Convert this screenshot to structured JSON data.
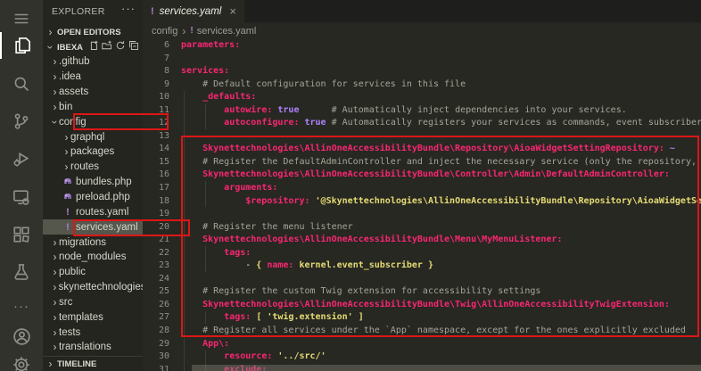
{
  "glyphs": {
    "yaml_bang": "!",
    "close": "×",
    "more": "···",
    "chevron": "›"
  },
  "colors": {
    "annotation_red": "#dd1616",
    "key_pink": "#f92672",
    "value_purple": "#ae81ff",
    "string_yellow": "#e6db74",
    "comment_gray": "#a6a599",
    "editor_bg": "#272822",
    "sidebar_bg": "#24251f"
  },
  "activity_bar": {
    "items": [
      "menu-icon",
      "explorer-icon",
      "search-icon",
      "source-control-icon",
      "run-debug-icon",
      "remote-explorer-icon",
      "extensions-icon",
      "test-beaker-icon",
      "more-icon",
      "account-icon",
      "settings-gear-icon"
    ],
    "active": "explorer-icon"
  },
  "sidebar": {
    "title": "EXPLORER",
    "open_editors_label": "OPEN EDITORS",
    "workspace_label": "IBEXA",
    "timeline_label": "TIMELINE",
    "workspace_actions": [
      "new-file-icon",
      "new-folder-icon",
      "refresh-icon",
      "collapse-all-icon"
    ],
    "tree": [
      {
        "label": ".github",
        "type": "folder",
        "depth": 1
      },
      {
        "label": ".idea",
        "type": "folder",
        "depth": 1
      },
      {
        "label": "assets",
        "type": "folder",
        "depth": 1
      },
      {
        "label": "bin",
        "type": "folder",
        "depth": 1
      },
      {
        "label": "config",
        "type": "folder",
        "depth": 1,
        "expanded": true,
        "boxed": true
      },
      {
        "label": "graphql",
        "type": "folder",
        "depth": 2
      },
      {
        "label": "packages",
        "type": "folder",
        "depth": 2
      },
      {
        "label": "routes",
        "type": "folder",
        "depth": 2
      },
      {
        "label": "bundles.php",
        "type": "php",
        "depth": 2
      },
      {
        "label": "preload.php",
        "type": "php",
        "depth": 2
      },
      {
        "label": "routes.yaml",
        "type": "yaml",
        "depth": 2
      },
      {
        "label": "services.yaml",
        "type": "yaml",
        "depth": 2,
        "selected": true,
        "boxed": true
      },
      {
        "label": "migrations",
        "type": "folder",
        "depth": 1
      },
      {
        "label": "node_modules",
        "type": "folder",
        "depth": 1
      },
      {
        "label": "public",
        "type": "folder",
        "depth": 1
      },
      {
        "label": "skynettechnologies",
        "type": "folder",
        "depth": 1
      },
      {
        "label": "src",
        "type": "folder",
        "depth": 1
      },
      {
        "label": "templates",
        "type": "folder",
        "depth": 1
      },
      {
        "label": "tests",
        "type": "folder",
        "depth": 1
      },
      {
        "label": "translations",
        "type": "folder",
        "depth": 1
      }
    ]
  },
  "editor": {
    "tab": {
      "label": "services.yaml"
    },
    "breadcrumb": [
      "config",
      "services.yaml"
    ],
    "lines": [
      {
        "num": 6,
        "segments": [
          [
            "parameters:",
            "key"
          ]
        ]
      },
      {
        "num": 7,
        "segments": []
      },
      {
        "num": 8,
        "segments": [
          [
            "services:",
            "key"
          ]
        ]
      },
      {
        "num": 9,
        "segments": [
          [
            "    ",
            "pln"
          ],
          [
            "# Default configuration for services in this file",
            "cmt"
          ]
        ]
      },
      {
        "num": 10,
        "segments": [
          [
            "    ",
            "pln"
          ],
          [
            "_defaults:",
            "key"
          ]
        ]
      },
      {
        "num": 11,
        "segments": [
          [
            "        ",
            "pln"
          ],
          [
            "autowire:",
            "key"
          ],
          [
            " ",
            "pln"
          ],
          [
            "true",
            "val"
          ],
          [
            "      ",
            "pln"
          ],
          [
            "# Automatically inject dependencies into your services.",
            "cmt"
          ]
        ]
      },
      {
        "num": 12,
        "segments": [
          [
            "        ",
            "pln"
          ],
          [
            "autoconfigure:",
            "key"
          ],
          [
            " ",
            "pln"
          ],
          [
            "true",
            "val"
          ],
          [
            " ",
            "pln"
          ],
          [
            "# Automatically registers your services as commands, event subscribers",
            "cmt"
          ]
        ]
      },
      {
        "num": 13,
        "segments": []
      },
      {
        "num": 14,
        "segments": [
          [
            "    ",
            "pln"
          ],
          [
            "Skynettechnologies\\AllinOneAccessibilityBundle\\Repository\\AioaWidgetSettingRepository:",
            "key"
          ],
          [
            " ",
            "pln"
          ],
          [
            "~",
            "val"
          ]
        ]
      },
      {
        "num": 15,
        "segments": [
          [
            "    ",
            "pln"
          ],
          [
            "# Register the DefaultAdminController and inject the necessary service (only the repository,",
            "cmt"
          ]
        ]
      },
      {
        "num": 16,
        "segments": [
          [
            "    ",
            "pln"
          ],
          [
            "Skynettechnologies\\AllinOneAccessibilityBundle\\Controller\\Admin\\DefaultAdminController:",
            "key"
          ]
        ]
      },
      {
        "num": 17,
        "segments": [
          [
            "        ",
            "pln"
          ],
          [
            "arguments:",
            "key"
          ]
        ]
      },
      {
        "num": 18,
        "segments": [
          [
            "            ",
            "pln"
          ],
          [
            "$repository:",
            "key"
          ],
          [
            " ",
            "pln"
          ],
          [
            "'@Skynettechnologies\\AllinOneAccessibilityBundle\\Repository\\AioaWidgetSe",
            "str"
          ]
        ]
      },
      {
        "num": 19,
        "segments": []
      },
      {
        "num": 20,
        "segments": [
          [
            "    ",
            "pln"
          ],
          [
            "# Register the menu listener",
            "cmt"
          ]
        ]
      },
      {
        "num": 21,
        "segments": [
          [
            "    ",
            "pln"
          ],
          [
            "Skynettechnologies\\AllinOneAccessibilityBundle\\Menu\\MyMenuListener:",
            "key"
          ]
        ]
      },
      {
        "num": 22,
        "segments": [
          [
            "        ",
            "pln"
          ],
          [
            "tags:",
            "key"
          ]
        ]
      },
      {
        "num": 23,
        "segments": [
          [
            "            - ",
            "pln"
          ],
          [
            "{ ",
            "str"
          ],
          [
            "name:",
            "key"
          ],
          [
            " ",
            "pln"
          ],
          [
            "kernel.event_subscriber }",
            "str"
          ]
        ]
      },
      {
        "num": 24,
        "segments": []
      },
      {
        "num": 25,
        "segments": [
          [
            "    ",
            "pln"
          ],
          [
            "# Register the custom Twig extension for accessibility settings",
            "cmt"
          ]
        ]
      },
      {
        "num": 26,
        "segments": [
          [
            "    ",
            "pln"
          ],
          [
            "Skynettechnologies\\AllinOneAccessibilityBundle\\Twig\\AllinOneAccessibilityTwigExtension:",
            "key"
          ]
        ]
      },
      {
        "num": 27,
        "segments": [
          [
            "        ",
            "pln"
          ],
          [
            "tags:",
            "key"
          ],
          [
            " ",
            "pln"
          ],
          [
            "[ 'twig.extension' ]",
            "str"
          ]
        ]
      },
      {
        "num": 28,
        "segments": [
          [
            "    ",
            "pln"
          ],
          [
            "# Register all services under the `App` namespace, except for the ones explicitly excluded",
            "cmt"
          ]
        ]
      },
      {
        "num": 29,
        "segments": [
          [
            "    ",
            "pln"
          ],
          [
            "App\\:",
            "key"
          ]
        ]
      },
      {
        "num": 30,
        "segments": [
          [
            "        ",
            "pln"
          ],
          [
            "resource:",
            "key"
          ],
          [
            " ",
            "pln"
          ],
          [
            "'../src/'",
            "str"
          ]
        ]
      },
      {
        "num": 31,
        "segments": [
          [
            "        ",
            "pln"
          ],
          [
            "exclude:",
            "key"
          ]
        ]
      }
    ]
  }
}
